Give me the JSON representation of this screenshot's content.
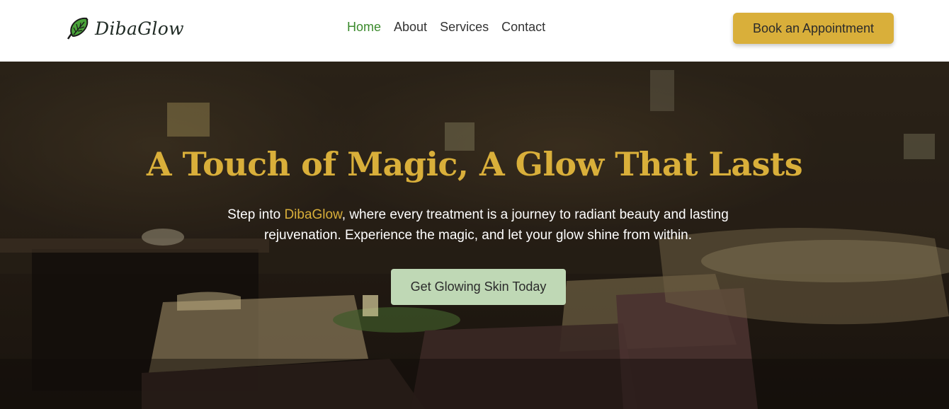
{
  "brand": {
    "name": "DibaGlow",
    "accent_color": "#d9af3a",
    "logo_icon": "leaf-icon"
  },
  "nav": {
    "items": [
      {
        "label": "Home",
        "active": true
      },
      {
        "label": "About",
        "active": false
      },
      {
        "label": "Services",
        "active": false
      },
      {
        "label": "Contact",
        "active": false
      }
    ],
    "active_color": "#3b8a2c",
    "cta_label": "Book an Appointment"
  },
  "hero": {
    "title": "A Touch of Magic, A Glow That Lasts",
    "subtitle_prefix": "Step into ",
    "subtitle_brand": "DibaGlow",
    "subtitle_suffix": ", where every treatment is a journey to radiant beauty and lasting rejuvenation. Experience the magic, and let your glow shine from within.",
    "cta_label": "Get Glowing Skin Today",
    "cta_color": "#bfd8b5"
  }
}
